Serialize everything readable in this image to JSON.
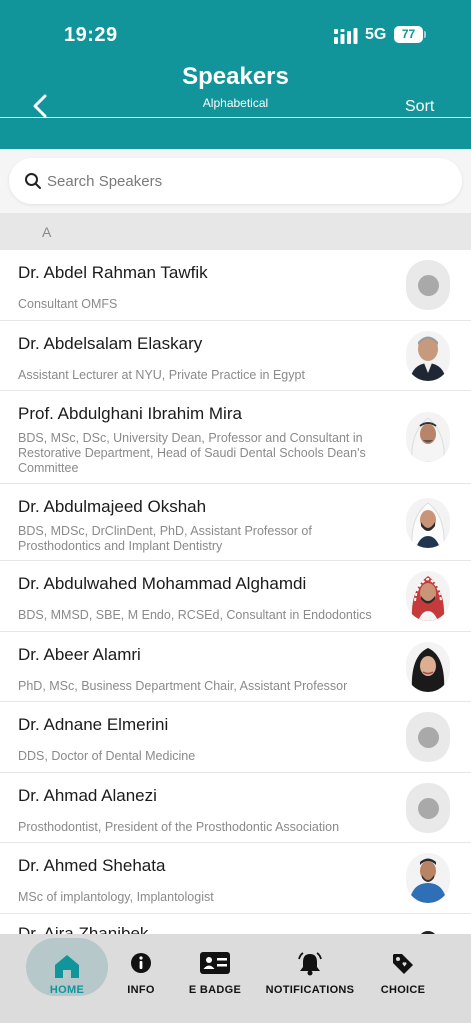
{
  "status": {
    "time": "19:29",
    "network": "5G",
    "battery": "77"
  },
  "header": {
    "title": "Speakers",
    "subtitle": "Alphabetical",
    "sort_label": "Sort"
  },
  "search": {
    "placeholder": "Search Speakers"
  },
  "section": {
    "letter": "A"
  },
  "speakers": [
    {
      "name": "Dr. Abdel Rahman Tawfik",
      "desc": "Consultant OMFS",
      "photo": "placeholder"
    },
    {
      "name": "Dr. Abdelsalam Elaskary",
      "desc": "Assistant Lecturer at NYU, Private Practice in Egypt",
      "photo": "man-grey-hair"
    },
    {
      "name": "Prof. Abdulghani Ibrahim Mira",
      "desc": "BDS, MSc, DSc, University Dean, Professor and Consultant in Restorative Department, Head of Saudi Dental Schools Dean's Committee",
      "photo": "man-ghutra-white"
    },
    {
      "name": "Dr. Abdulmajeed Okshah",
      "desc": "BDS, MDSc, DrClinDent, PhD, Assistant Professor of Prosthodontics and Implant Dentistry",
      "photo": "man-ghutra-white"
    },
    {
      "name": "Dr. Abdulwahed Mohammad Alghamdi",
      "desc": "BDS, MMSD, SBE, M Endo, RCSEd, Consultant in Endodontics",
      "photo": "man-shemagh-red"
    },
    {
      "name": "Dr. Abeer Alamri",
      "desc": "PhD, MSc, Business Department Chair, Assistant Professor",
      "photo": "woman-hijab"
    },
    {
      "name": "Dr. Adnane Elmerini",
      "desc": "DDS, Doctor of Dental Medicine",
      "photo": "placeholder"
    },
    {
      "name": "Dr. Ahmad Alanezi",
      "desc": "Prosthodontist, President of the Prosthodontic Association",
      "photo": "placeholder"
    },
    {
      "name": "Dr. Ahmed Shehata",
      "desc": "MSc of implantology, Implantologist",
      "photo": "man-blue-shirt"
    },
    {
      "name": "Dr. Aira Zhanibek",
      "desc": "",
      "photo": "partial"
    }
  ],
  "nav": [
    {
      "label": "HOME",
      "icon": "home-icon"
    },
    {
      "label": "INFO",
      "icon": "info-icon"
    },
    {
      "label": "E BADGE",
      "icon": "badge-icon"
    },
    {
      "label": "NOTIFICATIONS",
      "icon": "bell-icon"
    },
    {
      "label": "CHOICE",
      "icon": "tag-icon"
    }
  ],
  "colors": {
    "brand": "#11959a",
    "nav_bg": "#dcdcdc",
    "home_pill": "#b7c8cb"
  }
}
